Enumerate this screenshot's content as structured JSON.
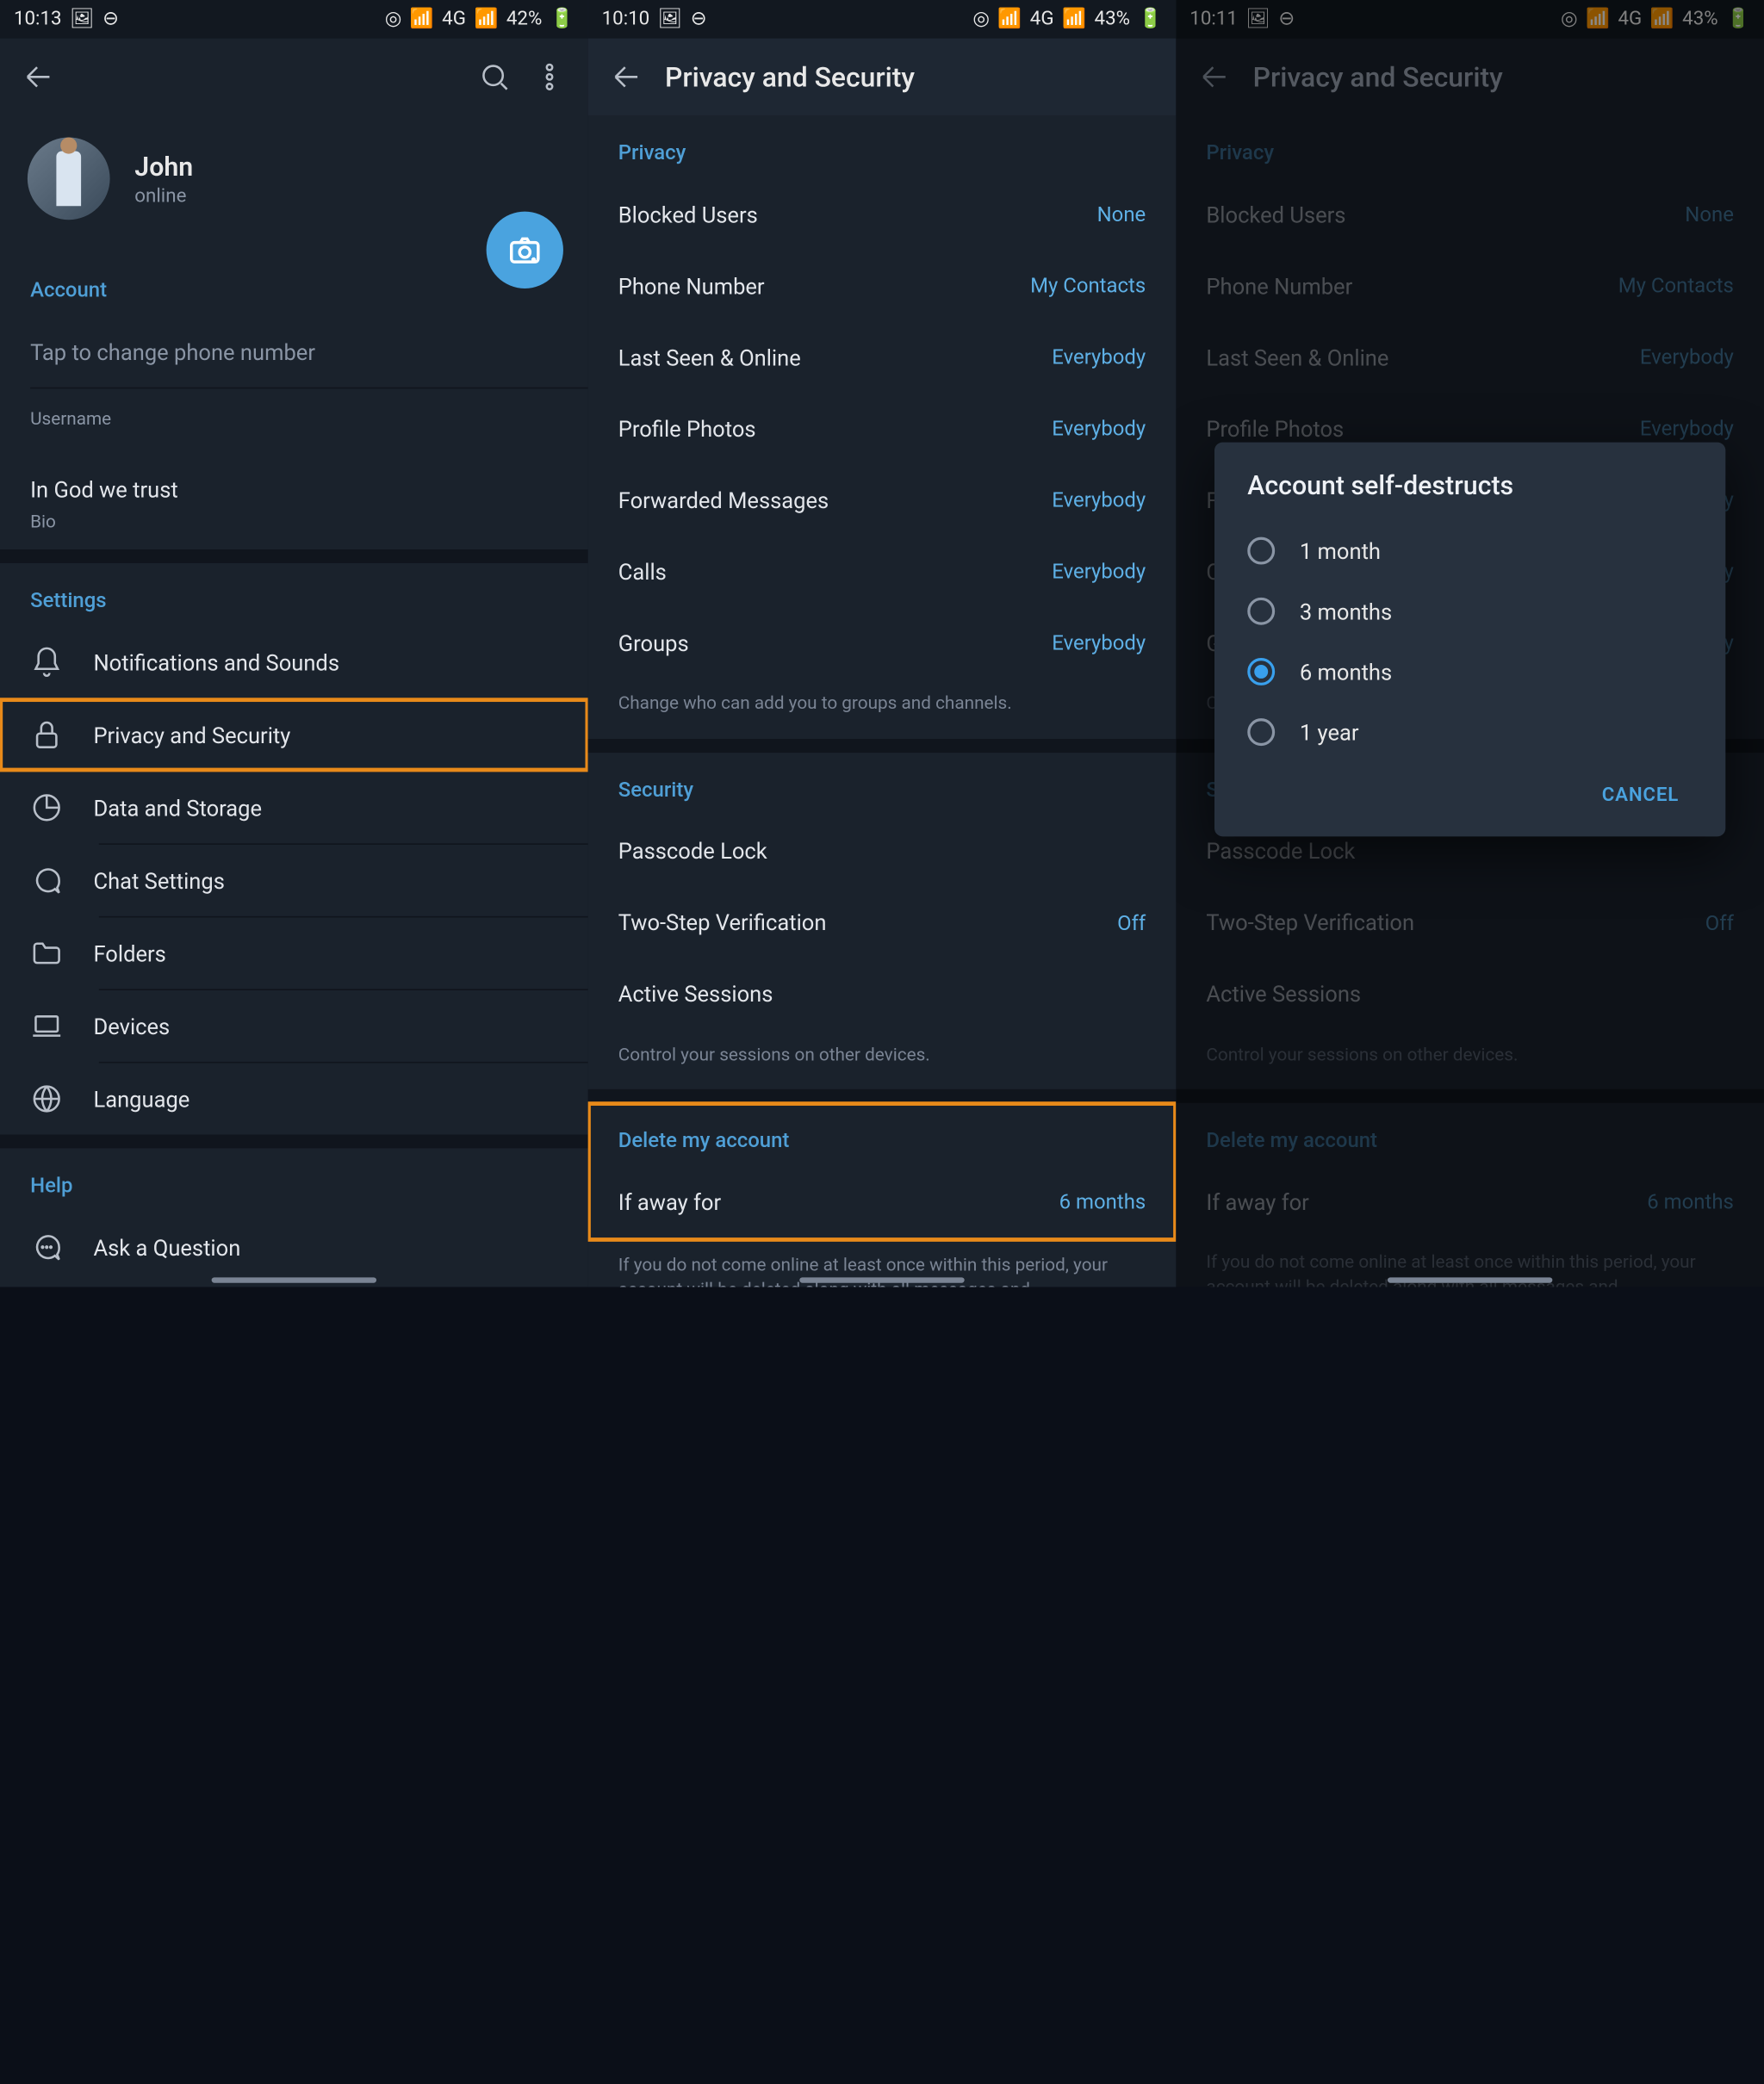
{
  "screen1": {
    "status": {
      "time": "10:13",
      "battery": "42%",
      "net": "4G"
    },
    "profile": {
      "name": "John",
      "status": "online"
    },
    "account": {
      "header": "Account",
      "phone_hint": "Tap to change phone number",
      "username_label": "Username",
      "bio_value": "In God we trust",
      "bio_label": "Bio"
    },
    "settings": {
      "header": "Settings",
      "items": [
        "Notifications and Sounds",
        "Privacy and Security",
        "Data and Storage",
        "Chat Settings",
        "Folders",
        "Devices",
        "Language"
      ]
    },
    "help": {
      "header": "Help",
      "ask": "Ask a Question"
    }
  },
  "screen2": {
    "status": {
      "time": "10:10",
      "battery": "43%",
      "net": "4G"
    },
    "title": "Privacy and Security",
    "privacy": {
      "header": "Privacy",
      "rows": [
        {
          "label": "Blocked Users",
          "value": "None"
        },
        {
          "label": "Phone Number",
          "value": "My Contacts"
        },
        {
          "label": "Last Seen & Online",
          "value": "Everybody"
        },
        {
          "label": "Profile Photos",
          "value": "Everybody"
        },
        {
          "label": "Forwarded Messages",
          "value": "Everybody"
        },
        {
          "label": "Calls",
          "value": "Everybody"
        },
        {
          "label": "Groups",
          "value": "Everybody"
        }
      ],
      "hint": "Change who can add you to groups and channels."
    },
    "security": {
      "header": "Security",
      "rows": [
        {
          "label": "Passcode Lock",
          "value": ""
        },
        {
          "label": "Two-Step Verification",
          "value": "Off"
        },
        {
          "label": "Active Sessions",
          "value": ""
        }
      ],
      "hint": "Control your sessions on other devices."
    },
    "delete": {
      "header": "Delete my account",
      "row": {
        "label": "If away for",
        "value": "6 months"
      },
      "hint": "If you do not come online at least once within this period, your account will be deleted along with all messages and"
    }
  },
  "screen3": {
    "status": {
      "time": "10:11",
      "battery": "43%",
      "net": "4G"
    },
    "title": "Privacy and Security",
    "dialog": {
      "title": "Account self-destructs",
      "options": [
        "1 month",
        "3 months",
        "6 months",
        "1 year"
      ],
      "selected": 2,
      "cancel": "CANCEL"
    }
  }
}
